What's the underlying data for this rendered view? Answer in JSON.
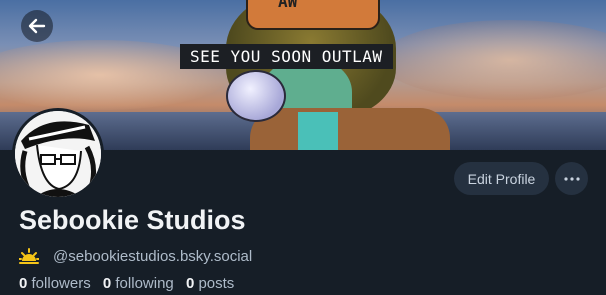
{
  "banner": {
    "caption": "SEE YOU SOON OUTLAW",
    "hat_text": "AW"
  },
  "profile": {
    "display_name": "Sebookie Studios",
    "handle": "@sebookiestudios.bsky.social",
    "edit_label": "Edit Profile",
    "more_icon": "ellipsis-icon",
    "badge_icon": "sun-icon",
    "back_icon": "arrow-left-icon"
  },
  "stats": {
    "followers": {
      "count": "0",
      "label": "followers"
    },
    "following": {
      "count": "0",
      "label": "following"
    },
    "posts": {
      "count": "0",
      "label": "posts"
    }
  },
  "colors": {
    "background": "#161e27",
    "button": "#253140",
    "badge": "#f5c518"
  }
}
